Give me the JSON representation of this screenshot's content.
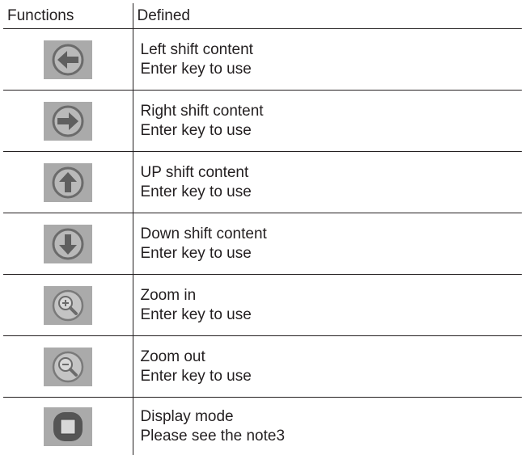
{
  "table": {
    "headers": [
      "Functions",
      "Defined"
    ],
    "rows": [
      {
        "icon": "left-arrow-icon",
        "title": "Left shift content",
        "note": "Enter key to use"
      },
      {
        "icon": "right-arrow-icon",
        "title": "Right shift content",
        "note": "Enter key to use"
      },
      {
        "icon": "up-arrow-icon",
        "title": "UP shift content",
        "note": "Enter key to use"
      },
      {
        "icon": "down-arrow-icon",
        "title": "Down shift content",
        "note": "Enter key to use"
      },
      {
        "icon": "zoom-in-icon",
        "title": "Zoom in",
        "note": "Enter key to use"
      },
      {
        "icon": "zoom-out-icon",
        "title": "Zoom out",
        "note": "Enter key to use"
      },
      {
        "icon": "display-mode-icon",
        "title": "Display mode",
        "note": "Please see the note3"
      }
    ]
  },
  "colors": {
    "text": "#231f20",
    "icon_background": "#aaaaaa",
    "icon_stroke": "#6b6b6b",
    "icon_fill": "#5f5f5f",
    "icon_light": "#d8d8d8"
  }
}
